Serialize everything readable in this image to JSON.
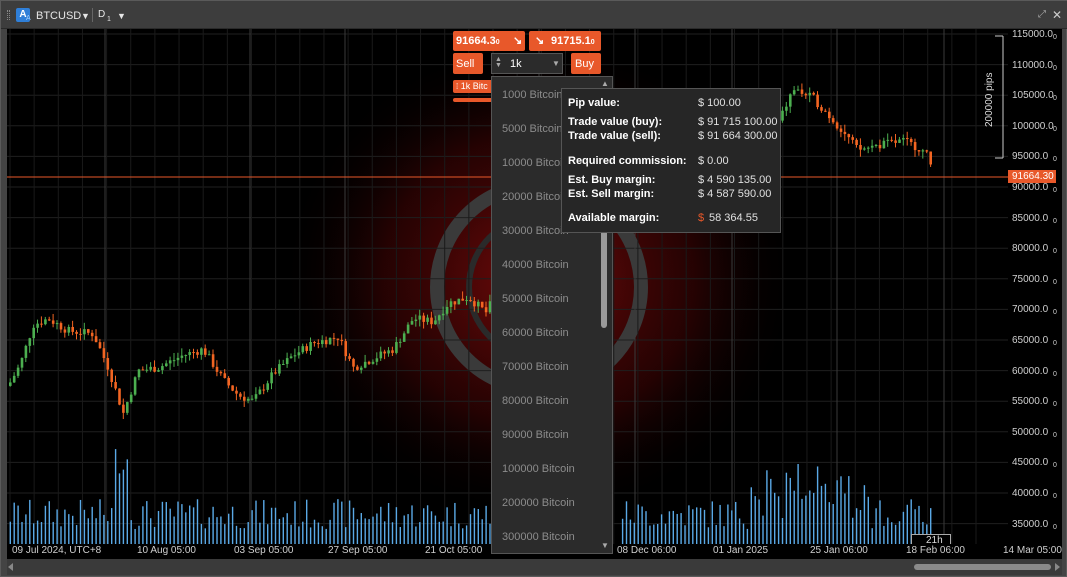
{
  "titlebar": {
    "account_letter": "A",
    "account_sub": "A",
    "symbol": "BTCUSD",
    "timeframe": "D",
    "timeframe_sub": "1",
    "restore_icon": "restore-icon",
    "close_icon": "close-icon"
  },
  "trade_panel": {
    "sell_price": "91664.3",
    "sell_price_sub": "0",
    "buy_price": "91715.1",
    "buy_price_sub": "0",
    "sell_label": "Sell",
    "buy_label": "Buy",
    "volume_value": "1k",
    "position_tag": "1k Bitc"
  },
  "volume_dropdown": {
    "options": [
      "1000 Bitcoin",
      "5000 Bitcoin",
      "10000 Bitcoin",
      "20000 Bitcoin",
      "30000 Bitcoin",
      "40000 Bitcoin",
      "50000 Bitcoin",
      "60000 Bitcoin",
      "70000 Bitcoin",
      "80000 Bitcoin",
      "90000 Bitcoin",
      "100000 Bitcoin",
      "200000 Bitcoin",
      "300000 Bitcoin"
    ]
  },
  "tooltip": {
    "pip_label": "Pip value:",
    "pip_value": "$ 100.00",
    "trade_buy_label": "Trade value (buy):",
    "trade_buy_value": "$ 91 715 100.00",
    "trade_sell_label": "Trade value (sell):",
    "trade_sell_value": "$ 91 664 300.00",
    "commission_label": "Required commission:",
    "commission_value": "$ 0.00",
    "buy_margin_label": "Est. Buy margin:",
    "buy_margin_value": "$ 4 590 135.00",
    "sell_margin_label": "Est. Sell margin:",
    "sell_margin_value": "$ 4 587 590.00",
    "avail_label": "Available margin:",
    "avail_currency": "$",
    "avail_value": "58 364.55"
  },
  "chart": {
    "price_axis": [
      "115000.0",
      "110000.0",
      "105000.0",
      "100000.0",
      "95000.0",
      "90000.0",
      "85000.0",
      "80000.0",
      "75000.0",
      "70000.0",
      "65000.0",
      "60000.0",
      "55000.0",
      "50000.0",
      "45000.0",
      "40000.0",
      "35000.0"
    ],
    "price_axis_sub": "0",
    "current_price": "91664.30",
    "pips_label": "200000 pips",
    "time_axis": [
      "09 Jul 2024, UTC+8",
      "10 Aug 05:00",
      "03 Sep 05:00",
      "27 Sep 05:00",
      "21 Oct 05:00",
      "08 Dec 06:00",
      "01 Jan 2025",
      "25 Jan 06:00",
      "18 Feb 06:00",
      "14 Mar 05:00"
    ],
    "time_remaining": "21h"
  },
  "colors": {
    "bull": "#4caf50",
    "bear": "#f26522",
    "volume": "#5aa9e6",
    "accent": "#e8582a",
    "price_line": "#e8582a"
  }
}
